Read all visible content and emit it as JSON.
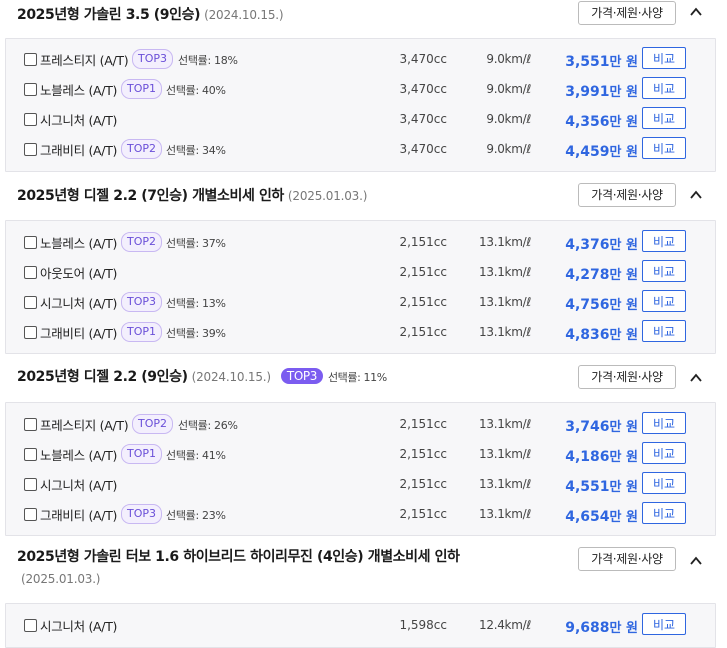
{
  "spec_button_label": "가격·제원·사양",
  "compare_button_label": "비교",
  "price_unit": "만 원",
  "sections": [
    {
      "title": "2025년형 가솔린 3.5 (9인승)",
      "date": "(2024.10.15.)",
      "badge": "",
      "badge_rate": "",
      "rows": [
        {
          "name": "프레스티지 (A/T)",
          "rank": "TOP3",
          "rate": "선택률: 18%",
          "cc": "3,470cc",
          "fuel": "9.0km/ℓ",
          "price": "3,551"
        },
        {
          "name": "노블레스 (A/T)",
          "rank": "TOP1",
          "rate": "선택률: 40%",
          "cc": "3,470cc",
          "fuel": "9.0km/ℓ",
          "price": "3,991"
        },
        {
          "name": "시그니처 (A/T)",
          "rank": "",
          "rate": "",
          "cc": "3,470cc",
          "fuel": "9.0km/ℓ",
          "price": "4,356"
        },
        {
          "name": "그래비티 (A/T)",
          "rank": "TOP2",
          "rate": "선택률: 34%",
          "cc": "3,470cc",
          "fuel": "9.0km/ℓ",
          "price": "4,459"
        }
      ]
    },
    {
      "title": "2025년형 디젤 2.2 (7인승) 개별소비세 인하",
      "date": "(2025.01.03.)",
      "badge": "",
      "badge_rate": "",
      "rows": [
        {
          "name": "노블레스 (A/T)",
          "rank": "TOP2",
          "rate": "선택률: 37%",
          "cc": "2,151cc",
          "fuel": "13.1km/ℓ",
          "price": "4,376"
        },
        {
          "name": "아웃도어 (A/T)",
          "rank": "",
          "rate": "",
          "cc": "2,151cc",
          "fuel": "13.1km/ℓ",
          "price": "4,278"
        },
        {
          "name": "시그니처 (A/T)",
          "rank": "TOP3",
          "rate": "선택률: 13%",
          "cc": "2,151cc",
          "fuel": "13.1km/ℓ",
          "price": "4,756"
        },
        {
          "name": "그래비티 (A/T)",
          "rank": "TOP1",
          "rate": "선택률: 39%",
          "cc": "2,151cc",
          "fuel": "13.1km/ℓ",
          "price": "4,836"
        }
      ]
    },
    {
      "title": "2025년형 디젤 2.2 (9인승)",
      "date": "(2024.10.15.)",
      "badge": "TOP3",
      "badge_rate": "선택률: 11%",
      "rows": [
        {
          "name": "프레스티지 (A/T)",
          "rank": "TOP2",
          "rate": "선택률: 26%",
          "cc": "2,151cc",
          "fuel": "13.1km/ℓ",
          "price": "3,746"
        },
        {
          "name": "노블레스 (A/T)",
          "rank": "TOP1",
          "rate": "선택률: 41%",
          "cc": "2,151cc",
          "fuel": "13.1km/ℓ",
          "price": "4,186"
        },
        {
          "name": "시그니처 (A/T)",
          "rank": "",
          "rate": "",
          "cc": "2,151cc",
          "fuel": "13.1km/ℓ",
          "price": "4,551"
        },
        {
          "name": "그래비티 (A/T)",
          "rank": "TOP3",
          "rate": "선택률: 23%",
          "cc": "2,151cc",
          "fuel": "13.1km/ℓ",
          "price": "4,654"
        }
      ]
    },
    {
      "title": "2025년형 가솔린 터보 1.6 하이브리드 하이리무진 (4인승) 개별소비세 인하",
      "date": "(2025.01.03.)",
      "badge": "",
      "badge_rate": "",
      "rows": [
        {
          "name": "시그니처 (A/T)",
          "rank": "",
          "rate": "",
          "cc": "1,598cc",
          "fuel": "12.4km/ℓ",
          "price": "9,688"
        }
      ]
    }
  ]
}
